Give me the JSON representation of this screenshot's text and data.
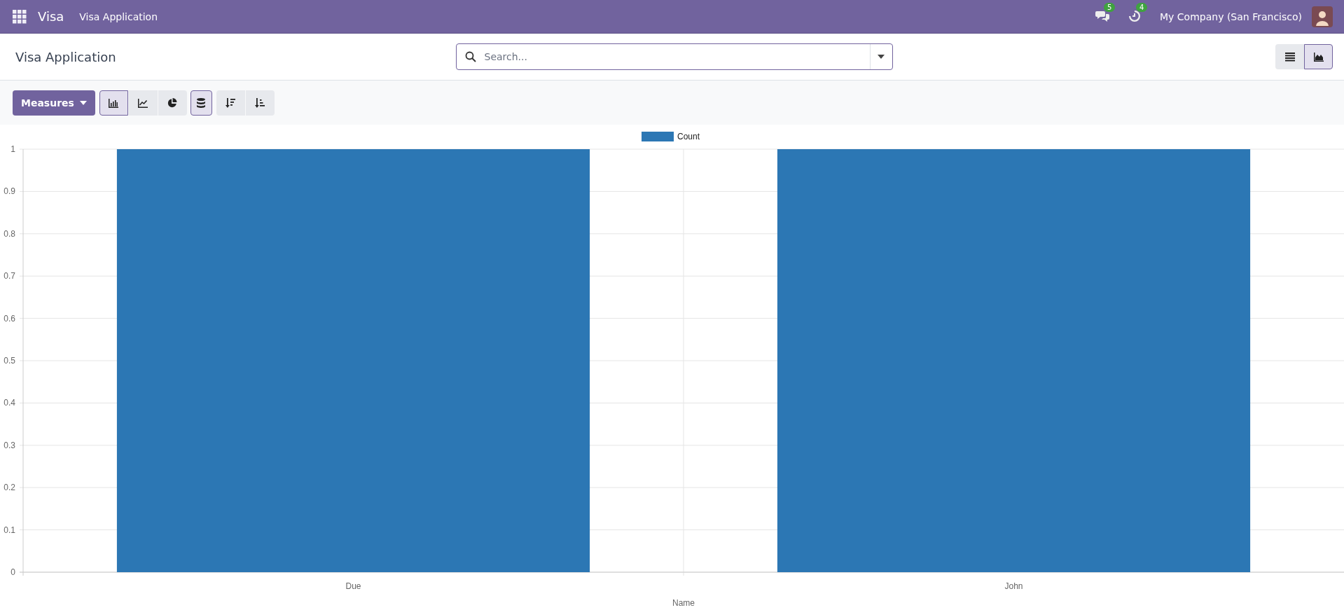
{
  "navbar": {
    "brand": "Visa",
    "menu": [
      "Visa Application"
    ],
    "messages_badge": "5",
    "activities_badge": "4",
    "company": "My Company (San Francisco)"
  },
  "control_panel": {
    "breadcrumb": "Visa Application",
    "search": {
      "placeholder": "Search..."
    },
    "view_switcher": [
      {
        "kind": "list",
        "selected": false
      },
      {
        "kind": "graph",
        "selected": true
      }
    ]
  },
  "toolbar": {
    "measures_button": "Measures",
    "chart_types": [
      {
        "kind": "bar",
        "selected": true
      },
      {
        "kind": "line",
        "selected": false
      },
      {
        "kind": "pie",
        "selected": false
      }
    ],
    "stacked": true,
    "order_buttons": [
      {
        "kind": "descending"
      },
      {
        "kind": "ascending"
      }
    ]
  },
  "chart_data": {
    "type": "bar",
    "xlabel": "Name",
    "categories": [
      "Due",
      "John"
    ],
    "series": [
      {
        "name": "Count",
        "color": "#2c77b4",
        "values": [
          1,
          1
        ]
      }
    ],
    "ylim": [
      0,
      1
    ],
    "grid": true,
    "yticks": [
      0,
      0.1,
      0.2,
      0.3,
      0.4,
      0.5,
      0.6,
      0.7,
      0.8,
      0.9,
      1
    ]
  }
}
